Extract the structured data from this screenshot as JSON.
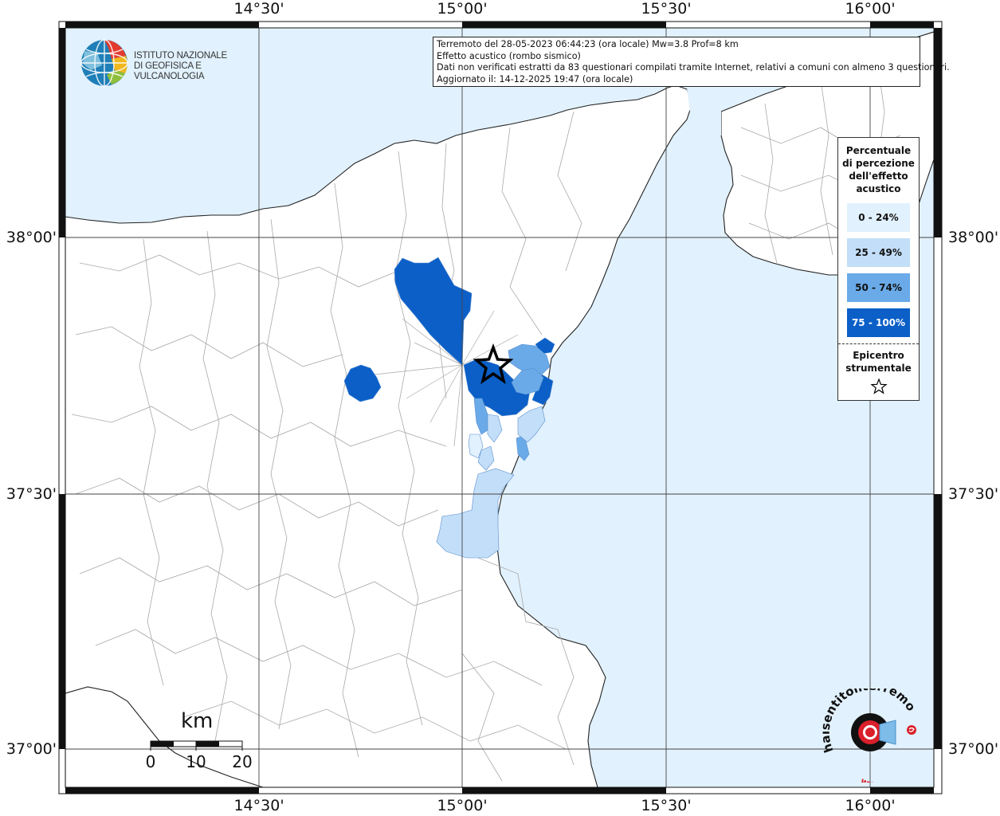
{
  "axes": {
    "top": [
      "14°30'",
      "15°00'",
      "15°30'",
      "16°00'"
    ],
    "bottom": [
      "14°30'",
      "15°00'",
      "15°30'",
      "16°00'"
    ],
    "left": [
      "38°00'",
      "37°30'",
      "37°00'"
    ],
    "right": [
      "38°00'",
      "37°30'",
      "37°00'"
    ]
  },
  "info": {
    "line1": "Terremoto del 28-05-2023 06:44:23 (ora locale) Mw=3.8 Prof=8 km",
    "line2": "Effetto acustico (rombo sismico)",
    "line3": "Dati non verificati estratti da 83 questionari compilati tramite Internet, relativi a comuni con almeno 3 questionari.",
    "line4": "Aggiornato il: 14-12-2025 19:47 (ora locale)"
  },
  "logo": {
    "line1": "ISTITUTO NAZIONALE",
    "line2": "DI GEOFISICA E VULCANOLOGIA"
  },
  "legend": {
    "title_lines": [
      "Percentuale",
      "di percezione",
      "dell'effetto",
      "acustico"
    ],
    "items": [
      {
        "label": "0 - 24%",
        "color": "#e1f1fd"
      },
      {
        "label": "25 - 49%",
        "color": "#c3def8"
      },
      {
        "label": "50 - 74%",
        "color": "#6aaae8"
      },
      {
        "label": "75 - 100%",
        "color": "#0b5fc7"
      }
    ],
    "epicenter_lines": [
      "Epicentro",
      "strumentale"
    ]
  },
  "scale": {
    "unit": "km",
    "ticks": [
      "0",
      "10",
      "20"
    ]
  },
  "watermark": {
    "text_black": "haisentitoilterremoto",
    "text_red": ".it",
    "text_www": "www."
  },
  "colors": {
    "sea": "#e1f1fd",
    "land": "#ffffff",
    "bin1": "#e1f1fd",
    "bin2": "#c3def8",
    "bin3": "#6aaae8",
    "bin4": "#0b5fc7",
    "grid": "#444444",
    "boundary": "#a8a8a8"
  }
}
